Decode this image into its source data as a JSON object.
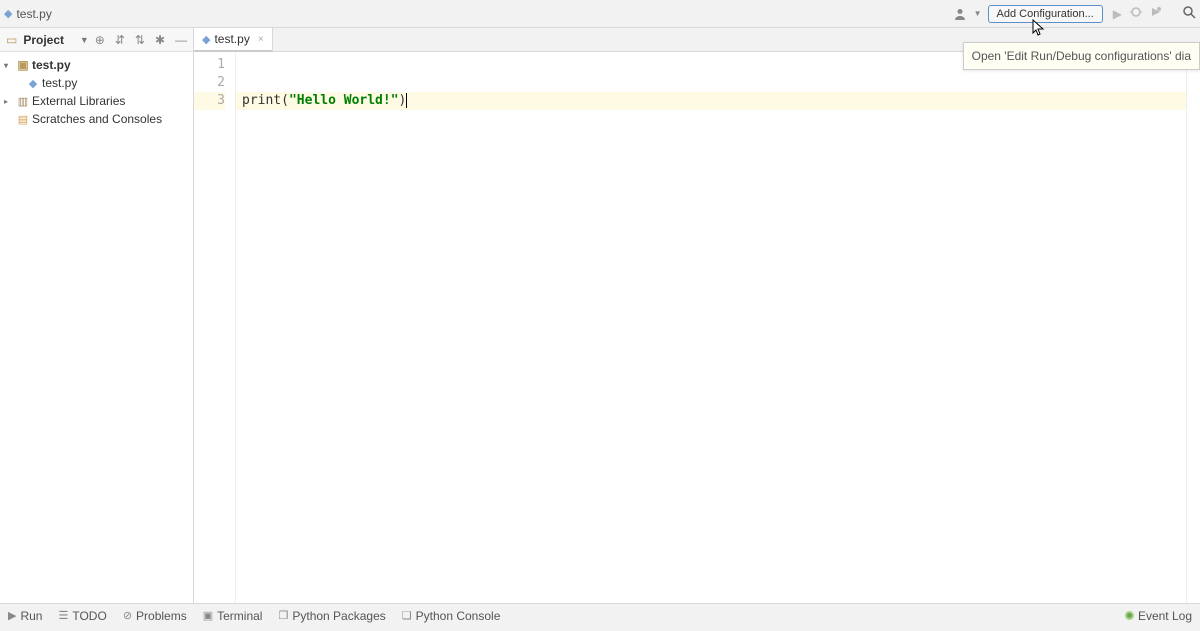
{
  "breadcrumb": {
    "file": "test.py"
  },
  "toolbar": {
    "add_config": "Add Configuration...",
    "tooltip": "Open 'Edit Run/Debug configurations' dia"
  },
  "sidebar": {
    "title": "Project",
    "tree": {
      "root": "test.py",
      "file": "test.py",
      "ext_libs": "External Libraries",
      "scratches": "Scratches and Consoles"
    }
  },
  "editor": {
    "tab": "test.py",
    "lines": {
      "l1": "1",
      "l2": "2",
      "l3": "3"
    },
    "code": {
      "fn": "print",
      "open": "(",
      "str": "\"Hello World!\"",
      "close": ")"
    }
  },
  "bottom": {
    "run": "Run",
    "todo": "TODO",
    "problems": "Problems",
    "terminal": "Terminal",
    "packages": "Python Packages",
    "console": "Python Console",
    "event_log": "Event Log"
  }
}
